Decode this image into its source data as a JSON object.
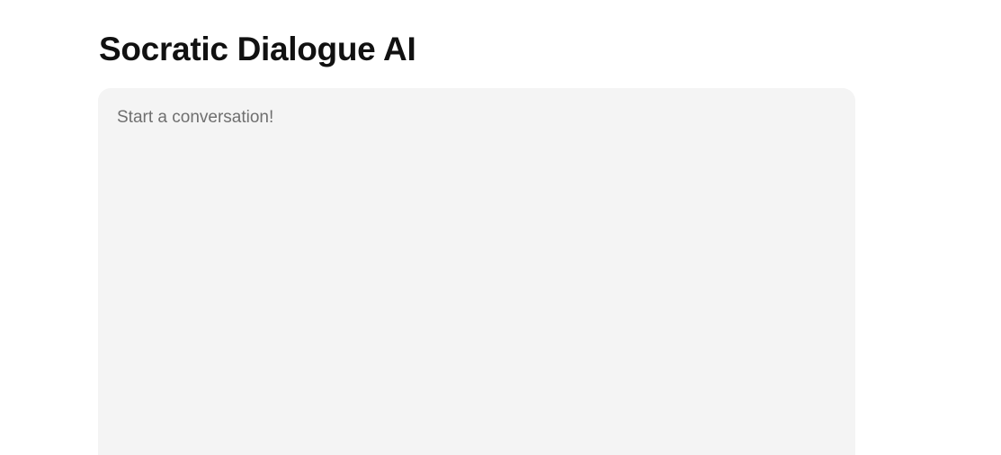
{
  "header": {
    "title": "Socratic Dialogue AI"
  },
  "chat": {
    "placeholder": "Start a conversation!"
  },
  "colors": {
    "background": "#ffffff",
    "panel": "#f4f4f4",
    "title_text": "#111111",
    "placeholder_text": "#6f6f6f"
  }
}
